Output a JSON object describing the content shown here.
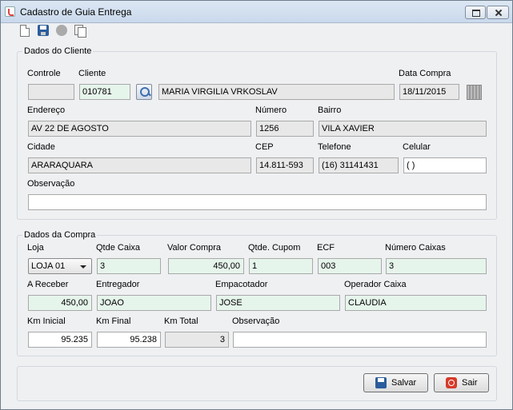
{
  "window": {
    "title": "Cadastro de Guia Entrega"
  },
  "cliente": {
    "legend": "Dados do Cliente",
    "controle": {
      "label": "Controle",
      "value": ""
    },
    "cliente": {
      "label": "Cliente",
      "code": "010781",
      "name": "MARIA VIRGILIA VRKOSLAV"
    },
    "data_compra": {
      "label": "Data Compra",
      "value": "18/11/2015"
    },
    "endereco": {
      "label": "Endereço",
      "value": "AV 22 DE AGOSTO"
    },
    "numero": {
      "label": "Número",
      "value": "1256"
    },
    "bairro": {
      "label": "Bairro",
      "value": "VILA XAVIER"
    },
    "cidade": {
      "label": "Cidade",
      "value": "ARARAQUARA"
    },
    "cep": {
      "label": "CEP",
      "value": "14.811-593"
    },
    "telefone": {
      "label": "Telefone",
      "value": "(16) 31141431"
    },
    "celular": {
      "label": "Celular",
      "value": "( )"
    },
    "observacao": {
      "label": "Observação",
      "value": ""
    }
  },
  "compra": {
    "legend": "Dados da Compra",
    "loja": {
      "label": "Loja",
      "value": "LOJA 01"
    },
    "qtde_caixa": {
      "label": "Qtde Caixa",
      "value": "3"
    },
    "valor_compra": {
      "label": "Valor Compra",
      "value": "450,00"
    },
    "qtde_cupom": {
      "label": "Qtde. Cupom",
      "value": "1"
    },
    "ecf": {
      "label": "ECF",
      "value": "003"
    },
    "numero_caixas": {
      "label": "Número Caixas",
      "value": "3"
    },
    "a_receber": {
      "label": "A Receber",
      "value": "450,00"
    },
    "entregador": {
      "label": "Entregador",
      "value": "JOAO"
    },
    "empacotador": {
      "label": "Empacotador",
      "value": "JOSE"
    },
    "operador_caixa": {
      "label": "Operador Caixa",
      "value": "CLAUDIA"
    },
    "km_inicial": {
      "label": "Km Inicial",
      "value": "95.235"
    },
    "km_final": {
      "label": "Km Final",
      "value": "95.238"
    },
    "km_total": {
      "label": "Km Total",
      "value": "3"
    },
    "observacao": {
      "label": "Observação",
      "value": ""
    }
  },
  "actions": {
    "save_label": "Salvar",
    "exit_label": "Sair"
  },
  "icons": [
    "new-icon",
    "save-icon",
    "print-icon",
    "copy-icon",
    "search-icon",
    "calendar-icon"
  ]
}
